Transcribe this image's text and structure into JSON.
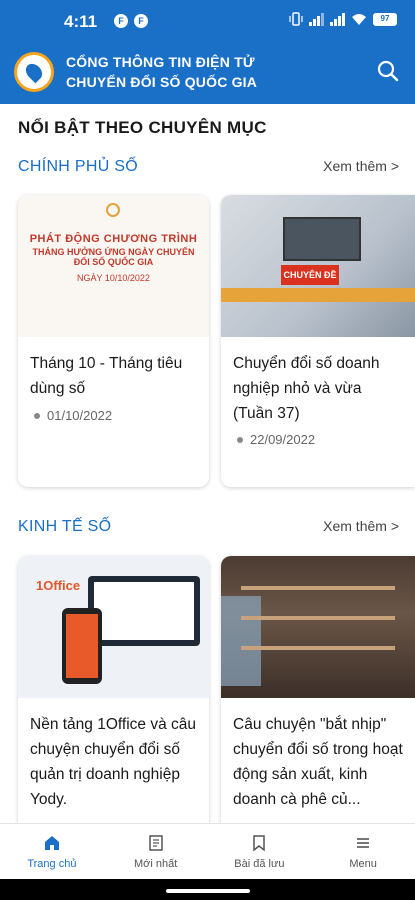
{
  "status_bar": {
    "time": "4:11",
    "app_badges": [
      "F",
      "F"
    ],
    "battery": "97"
  },
  "header": {
    "title_line1": "CỔNG THÔNG TIN ĐIỆN TỬ",
    "title_line2": "CHUYỂN ĐỔI SỐ QUỐC GIA"
  },
  "main": {
    "heading": "NỔI BẬT THEO CHUYÊN MỤC",
    "sections": [
      {
        "title": "CHÍNH PHỦ SỐ",
        "see_more": "Xem thêm >",
        "cards": [
          {
            "title": "Tháng 10 - Tháng tiêu dùng số",
            "date": "01/10/2022",
            "thumb_text": [
              "PHÁT ĐỘNG CHƯƠNG TRÌNH",
              "THÁNG HƯỞNG ỨNG NGÀY CHUYỂN ĐỔI SỐ QUỐC GIA",
              "NGÀY 10/10/2022"
            ]
          },
          {
            "title": "Chuyển đổi số doanh nghiệp nhỏ và vừa (Tuần 37)",
            "date": "22/09/2022",
            "thumb_text": [
              "CHUYÊN ĐỀ"
            ]
          }
        ]
      },
      {
        "title": "KINH TẾ SỐ",
        "see_more": "Xem thêm >",
        "cards": [
          {
            "title": "Nền tảng 1Office và câu chuyện chuyển đổi số quản trị doanh nghiệp Yody.",
            "date": "",
            "thumb_text": [
              "1Office"
            ]
          },
          {
            "title": "Câu chuyện \"bắt nhịp\" chuyển đổi số trong hoạt động sản xuất, kinh doanh cà phê củ...",
            "date": "",
            "thumb_text": []
          }
        ]
      }
    ]
  },
  "bottom_nav": [
    {
      "label": "Trang chủ",
      "icon": "home-icon",
      "active": true
    },
    {
      "label": "Mới nhất",
      "icon": "newspaper-icon",
      "active": false
    },
    {
      "label": "Bài đã lưu",
      "icon": "bookmark-icon",
      "active": false
    },
    {
      "label": "Menu",
      "icon": "menu-icon",
      "active": false
    }
  ],
  "colors": {
    "primary": "#1a6fc7",
    "accent": "#f4a51c"
  }
}
